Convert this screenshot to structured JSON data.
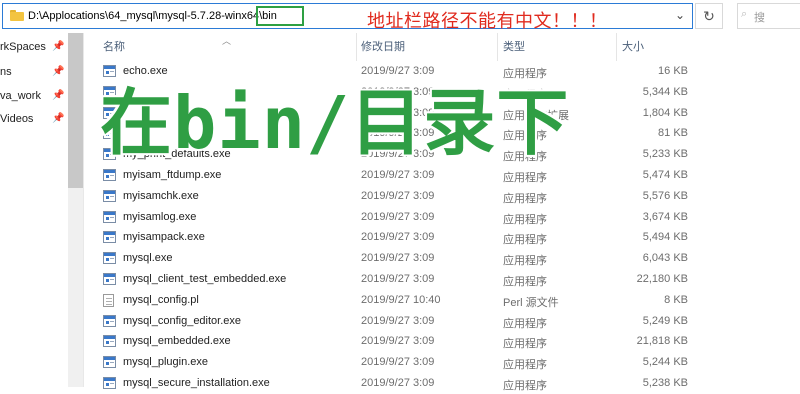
{
  "address_bar": {
    "path": "D:\\Applocations\\64_mysql\\mysql-5.7.28-winx64\\bin",
    "annotation": "地址栏路径不能有中文！！！",
    "refresh_icon": "refresh-icon",
    "dropdown_icon": "chevron-down-icon"
  },
  "search": {
    "placeholder": "搜"
  },
  "nav": {
    "items": [
      {
        "label": "rkSpaces"
      },
      {
        "label": "ns"
      },
      {
        "label": "va_work"
      },
      {
        "label": "Videos"
      }
    ]
  },
  "columns": {
    "name": "名称",
    "date": "修改日期",
    "type": "类型",
    "size": "大小"
  },
  "overlay_annotation": "在bin/目录下",
  "files": [
    {
      "name": "echo.exe",
      "date": "2019/9/27 3:09",
      "type": "应用程序",
      "size": "16 KB",
      "icon": "exe"
    },
    {
      "name": "",
      "date": "2019/9/27 3:09",
      "type": "应用程序",
      "size": "5,344 KB",
      "icon": "exe"
    },
    {
      "name": "",
      "date": "2019/9/27 3:09",
      "type": "应用程序扩展",
      "size": "1,804 KB",
      "icon": "exe"
    },
    {
      "name": "",
      "date": "2019/9/27 3:09",
      "type": "应用程序",
      "size": "81 KB",
      "icon": "exe"
    },
    {
      "name": "my_print_defaults.exe",
      "date": "2019/9/27 3:09",
      "type": "应用程序",
      "size": "5,233 KB",
      "icon": "exe"
    },
    {
      "name": "myisam_ftdump.exe",
      "date": "2019/9/27 3:09",
      "type": "应用程序",
      "size": "5,474 KB",
      "icon": "exe"
    },
    {
      "name": "myisamchk.exe",
      "date": "2019/9/27 3:09",
      "type": "应用程序",
      "size": "5,576 KB",
      "icon": "exe"
    },
    {
      "name": "myisamlog.exe",
      "date": "2019/9/27 3:09",
      "type": "应用程序",
      "size": "3,674 KB",
      "icon": "exe"
    },
    {
      "name": "myisampack.exe",
      "date": "2019/9/27 3:09",
      "type": "应用程序",
      "size": "5,494 KB",
      "icon": "exe"
    },
    {
      "name": "mysql.exe",
      "date": "2019/9/27 3:09",
      "type": "应用程序",
      "size": "6,043 KB",
      "icon": "exe"
    },
    {
      "name": "mysql_client_test_embedded.exe",
      "date": "2019/9/27 3:09",
      "type": "应用程序",
      "size": "22,180 KB",
      "icon": "exe"
    },
    {
      "name": "mysql_config.pl",
      "date": "2019/9/27 10:40",
      "type": "Perl 源文件",
      "size": "8 KB",
      "icon": "pl"
    },
    {
      "name": "mysql_config_editor.exe",
      "date": "2019/9/27 3:09",
      "type": "应用程序",
      "size": "5,249 KB",
      "icon": "exe"
    },
    {
      "name": "mysql_embedded.exe",
      "date": "2019/9/27 3:09",
      "type": "应用程序",
      "size": "21,818 KB",
      "icon": "exe"
    },
    {
      "name": "mysql_plugin.exe",
      "date": "2019/9/27 3:09",
      "type": "应用程序",
      "size": "5,244 KB",
      "icon": "exe"
    },
    {
      "name": "mysql_secure_installation.exe",
      "date": "2019/9/27 3:09",
      "type": "应用程序",
      "size": "5,238 KB",
      "icon": "exe"
    }
  ]
}
